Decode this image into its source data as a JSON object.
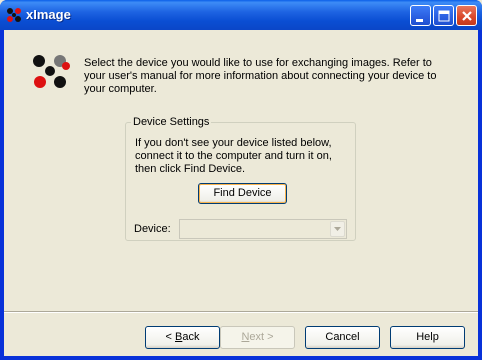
{
  "window": {
    "title": "xImage"
  },
  "intro": {
    "text": "Select the device you would like to use for exchanging images.  Refer to your user's manual for more information about connecting your device to your computer."
  },
  "device_settings": {
    "legend": "Device Settings",
    "instructions": "If you don't see your device listed below, connect it to the computer and turn it on, then click Find Device.",
    "find_device_label": "Find Device",
    "device_label": "Device:",
    "device_value": ""
  },
  "buttons": {
    "back_mnemonic": "B",
    "back_rest": "ack",
    "back_prefix": "< ",
    "next_mnemonic": "N",
    "next_rest": "ext >",
    "cancel": "Cancel",
    "help": "Help"
  },
  "icons": {
    "app": "ximage-logo-icon",
    "minimize": "minimize-icon",
    "maximize": "maximize-icon",
    "close": "close-icon",
    "dropdown": "chevron-down-icon"
  },
  "colors": {
    "titlebar": "#0a4ed3",
    "dialog_bg": "#ece9d8",
    "close_button": "#d9472a"
  }
}
